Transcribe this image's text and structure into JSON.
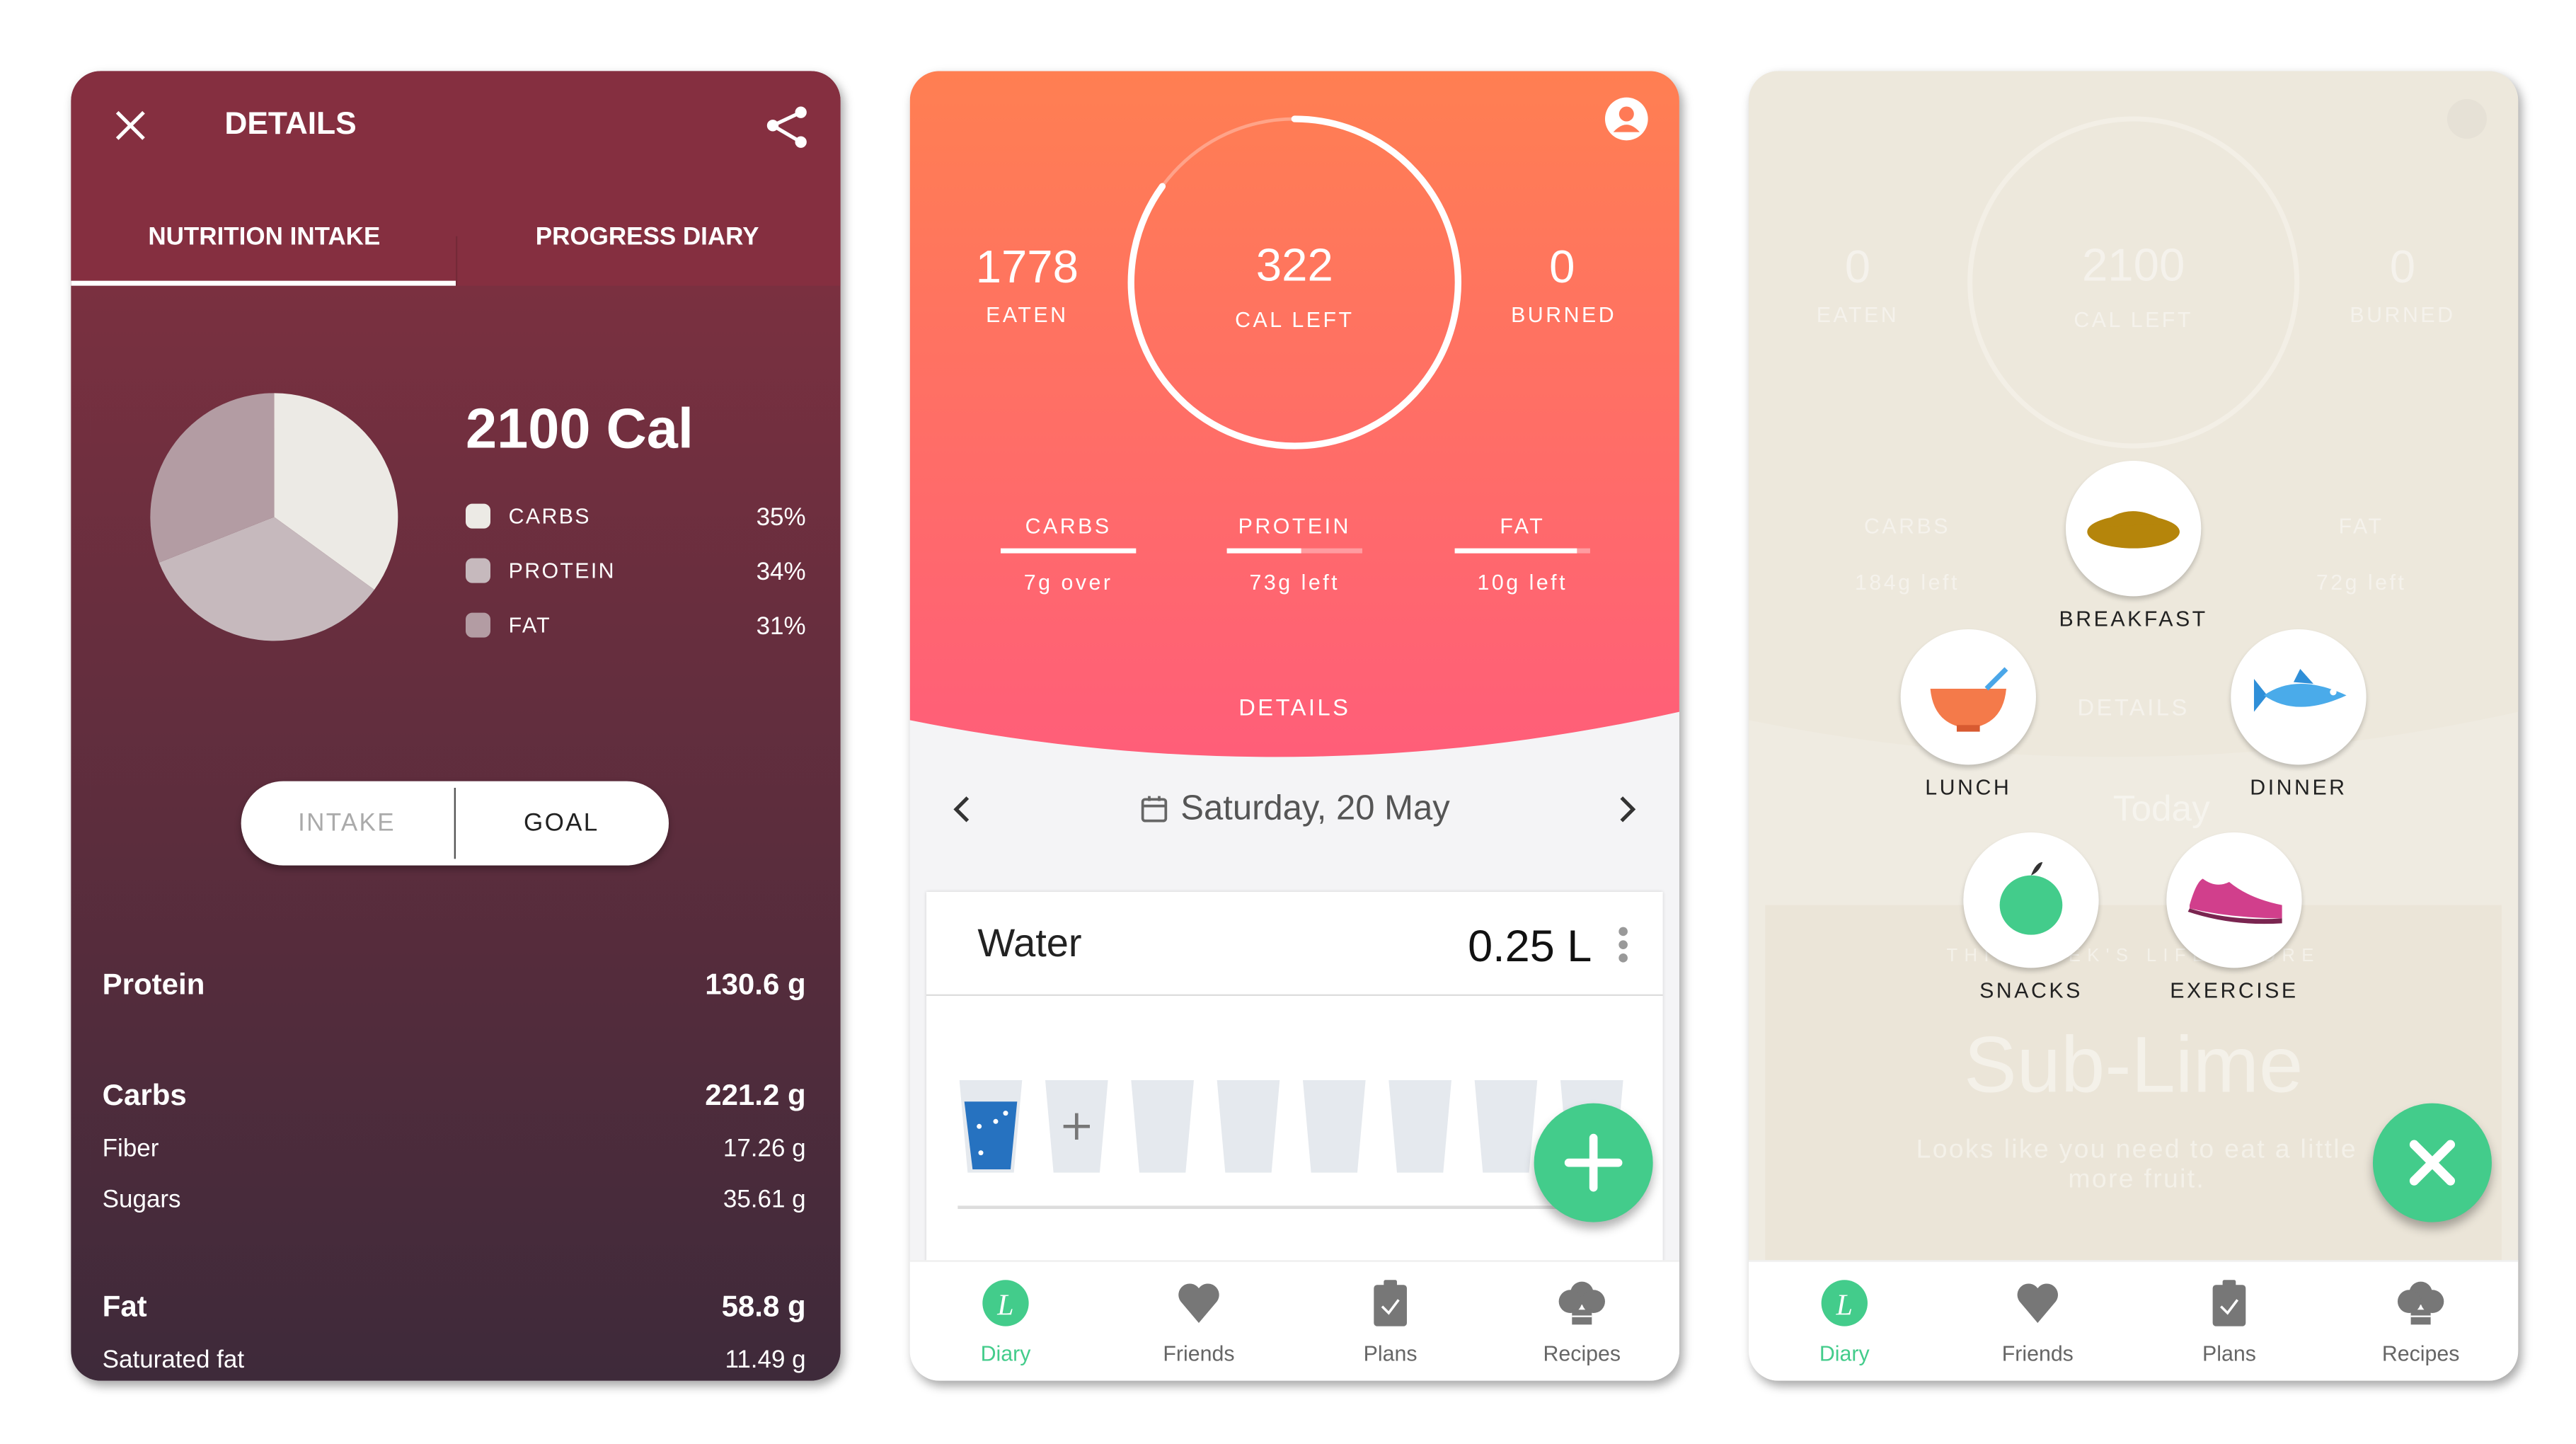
{
  "details_screen": {
    "title": "DETAILS",
    "tabs": [
      {
        "label": "NUTRITION INTAKE",
        "active": true
      },
      {
        "label": "PROGRESS DIARY",
        "active": false
      }
    ],
    "total": "2100 Cal",
    "chart_data": {
      "type": "pie",
      "categories": [
        "CARBS",
        "PROTEIN",
        "FAT"
      ],
      "values": [
        35,
        34,
        31
      ],
      "labels": [
        "35%",
        "34%",
        "31%"
      ],
      "colors": [
        "#eceae5",
        "#c6b9bd",
        "#b39ca3"
      ]
    },
    "toggle": {
      "intake": "INTAKE",
      "goal": "GOAL",
      "selected": "GOAL"
    },
    "nutrients": [
      {
        "name": "Protein",
        "value": "130.6 g",
        "main": true
      },
      {
        "name": "Carbs",
        "value": "221.2 g",
        "main": true
      },
      {
        "name": "Fiber",
        "value": "17.26 g",
        "main": false
      },
      {
        "name": "Sugars",
        "value": "35.61 g",
        "main": false
      },
      {
        "name": "Fat",
        "value": "58.8 g",
        "main": true
      },
      {
        "name": "Saturated fat",
        "value": "11.49 g",
        "main": false
      }
    ]
  },
  "diary_screen": {
    "eaten": {
      "value": "1778",
      "label": "EATEN"
    },
    "left": {
      "value": "322",
      "label": "CAL LEFT"
    },
    "burned": {
      "value": "0",
      "label": "BURNED"
    },
    "ring_progress": 0.85,
    "macros": [
      {
        "name": "CARBS",
        "status": "7g over",
        "progress": 1.0
      },
      {
        "name": "PROTEIN",
        "status": "73g left",
        "progress": 0.55
      },
      {
        "name": "FAT",
        "status": "10g left",
        "progress": 0.9
      }
    ],
    "details_label": "DETAILS",
    "date": "Saturday, 20 May",
    "water": {
      "title": "Water",
      "value": "0.25 L",
      "glasses_total": 8,
      "glasses_filled": 1
    }
  },
  "menu_screen": {
    "bg": {
      "eaten": "0",
      "eaten_label": "EATEN",
      "left": "2100",
      "left_label": "CAL LEFT",
      "burned": "0",
      "burned_label": "BURNED",
      "carbs": "CARBS",
      "carbs_status": "184g left",
      "fat": "FAT",
      "fat_status": "72g left",
      "details": "DETAILS",
      "date": "Today",
      "score_label": "THIS WEEK'S LIFE SCORE",
      "score": "Sub-Lime",
      "tip": "Looks like you need to eat a little more fruit."
    },
    "options": [
      {
        "label": "BREAKFAST",
        "icon": "bread-icon"
      },
      {
        "label": "LUNCH",
        "icon": "bowl-icon"
      },
      {
        "label": "DINNER",
        "icon": "fish-icon"
      },
      {
        "label": "SNACKS",
        "icon": "apple-icon"
      },
      {
        "label": "EXERCISE",
        "icon": "shoe-icon"
      }
    ]
  },
  "nav": [
    {
      "label": "Diary",
      "active": true
    },
    {
      "label": "Friends"
    },
    {
      "label": "Plans"
    },
    {
      "label": "Recipes"
    }
  ],
  "colors": {
    "accent": "#43cc8b",
    "maroon": "#852f40",
    "coral": "#ff7b54",
    "water": "#2672c0"
  }
}
